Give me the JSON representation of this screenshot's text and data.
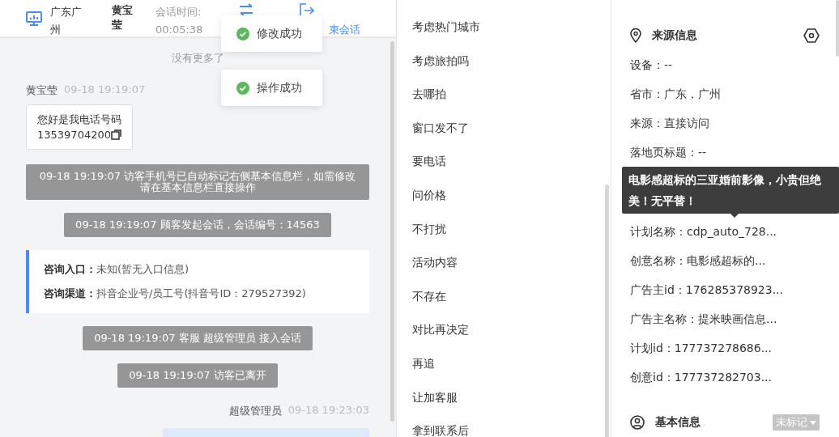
{
  "header": {
    "location": "广东广州",
    "visitor": "黄宝莹",
    "timer_label": "会话时间:",
    "timer": "00:05:38",
    "end_label": "束会话"
  },
  "toasts": [
    {
      "message": "修改成功"
    },
    {
      "message": "操作成功"
    }
  ],
  "chat": {
    "top_note": "没有更多了",
    "messages": [
      {
        "kind": "visitor",
        "sender": "黄宝莹",
        "time": "09-18 19:19:07",
        "lines": [
          "您好是我电话号码",
          "13539704200"
        ]
      },
      {
        "kind": "system",
        "text": "09-18 19:19:07 访客手机号已自动标记右侧基本信息栏，如需修改请在基本信息栏直接操作"
      },
      {
        "kind": "system",
        "text": "09-18 19:19:07 顾客发起会话，会话编号：14563"
      },
      {
        "kind": "entry",
        "rows": [
          {
            "label": "咨询入口：",
            "value": "未知(暂无入口信息)"
          },
          {
            "label": "咨询渠道：",
            "value": "抖音企业号/员工号(抖音号ID：279527392)"
          }
        ]
      },
      {
        "kind": "system",
        "text": "09-18 19:19:07 客服 超级管理员 接入会话"
      },
      {
        "kind": "system",
        "text": "09-18 19:19:07 访客已离开"
      },
      {
        "kind": "agent",
        "sender": "超级管理员",
        "time": "09-18 19:23:03"
      }
    ]
  },
  "quick_replies": [
    "考虑热门城市",
    "考虑旅拍吗",
    "去哪拍",
    "窗口发不了",
    "要电话",
    "问价格",
    "不打扰",
    "活动内容",
    "不存在",
    "对比再决定",
    "再追",
    "让加客服",
    "拿到联系后"
  ],
  "source_info": {
    "title": "来源信息",
    "rows_top": [
      "设备：--",
      "省市：广东，广州",
      "来源：直接访问",
      "落地页标题：--"
    ],
    "tooltip": "电影感超标的三亚婚前影像，小贵但绝美！无平替！",
    "rows_bottom": [
      "计划名称：cdp_auto_728...",
      "创意名称：电影感超标的...",
      "广告主id：176285378923...",
      "广告主名称：提米映画信息...",
      "计划id：177737278686...",
      "创意id：177737282703..."
    ]
  },
  "basic_info": {
    "title": "基本信息",
    "tag": "未标记"
  }
}
